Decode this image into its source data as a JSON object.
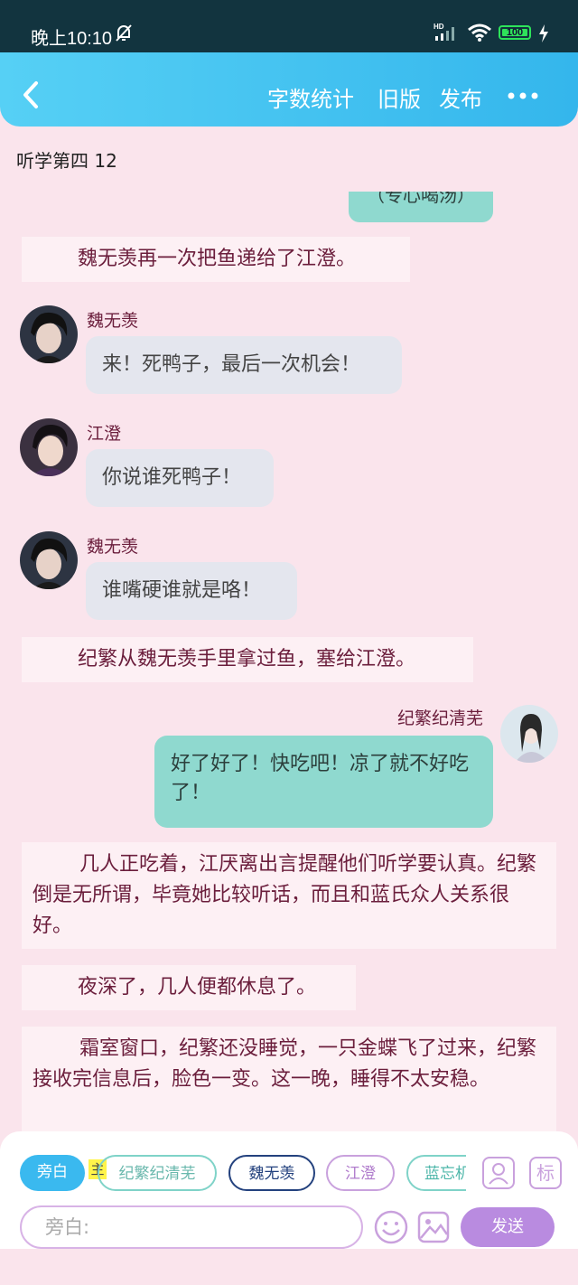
{
  "status_bar": {
    "time": "晚上10:10",
    "hd": "HD",
    "battery": "100"
  },
  "header": {
    "word_count": "字数统计",
    "old_version": "旧版",
    "publish": "发布"
  },
  "page_title": "听学第四 12",
  "partial_bubble_text": "（专心喝汤）",
  "messages": [
    {
      "type": "narration",
      "text": "魏无羡再一次把鱼递给了江澄。"
    },
    {
      "type": "left",
      "speaker": "魏无羡",
      "text": "来！死鸭子，最后一次机会！"
    },
    {
      "type": "left",
      "speaker": "江澄",
      "text": "你说谁死鸭子！"
    },
    {
      "type": "left",
      "speaker": "魏无羡",
      "text": "谁嘴硬谁就是咯！"
    },
    {
      "type": "narration",
      "text": "纪繁从魏无羡手里拿过鱼，塞给江澄。"
    },
    {
      "type": "right",
      "speaker": "纪繁纪清芜",
      "text": "好了好了！快吃吧！凉了就不好吃了！"
    },
    {
      "type": "narration",
      "text": "几人正吃着，江厌离出言提醒他们听学要认真。纪繁倒是无所谓，毕竟她比较听话，而且和蓝氏众人关系很好。"
    },
    {
      "type": "narration",
      "text": "夜深了，几人便都休息了。"
    },
    {
      "type": "narration",
      "text": "霜室窗口，纪繁还没睡觉，一只金蝶飞了过来，纪繁接收完信息后，脸色一变。这一晚，睡得不太安稳。"
    }
  ],
  "roles": [
    {
      "label": "旁白",
      "selected": true
    },
    {
      "label": "纪繁纪清芜",
      "host": true
    },
    {
      "label": "魏无羡"
    },
    {
      "label": "江澄"
    },
    {
      "label": "蓝忘机"
    }
  ],
  "host_badge": "主",
  "tag_button": "标",
  "input": {
    "placeholder": "旁白:"
  },
  "send_label": "发送",
  "colors": {
    "header": "#40c2f0",
    "narration_text": "#6b1e3c",
    "teal_bubble": "#8fd9cf",
    "gray_bubble": "#e4e6ee",
    "send": "#b98be0"
  }
}
